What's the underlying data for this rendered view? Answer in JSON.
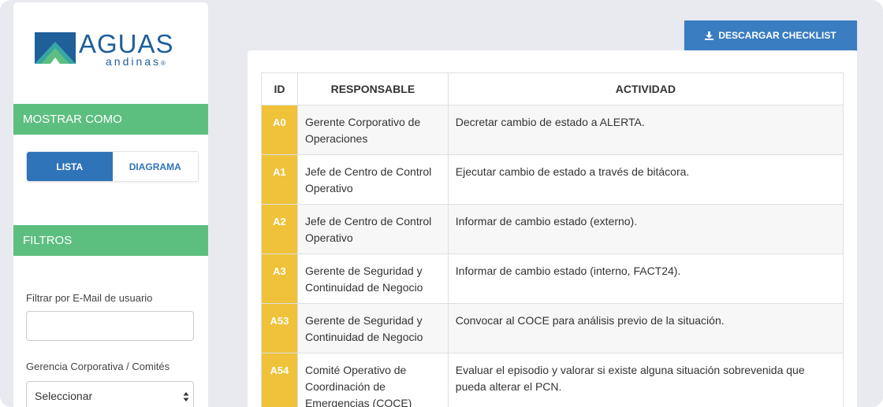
{
  "brand": {
    "name": "AGUAS",
    "sub": "andinas",
    "mark": "®",
    "colors": {
      "blue": "#1f5f9a",
      "green": "#5cbf80",
      "teal": "#38a7a3"
    }
  },
  "sidebar": {
    "show_as_header": "MOSTRAR COMO",
    "view_toggle": {
      "list_label": "LISTA",
      "diagram_label": "DIAGRAMA",
      "selected": "LISTA"
    },
    "filters_header": "FILTROS",
    "email_filter": {
      "label": "Filtrar por E-Mail de usuario",
      "value": "",
      "placeholder": ""
    },
    "management_filter": {
      "label": "Gerencia Corporativa / Comités",
      "selected": "Seleccionar"
    }
  },
  "main": {
    "download_button": {
      "label": "DESCARGAR CHECKLIST",
      "icon": "download-icon"
    },
    "table": {
      "headers": [
        "ID",
        "RESPONSABLE",
        "ACTIVIDAD"
      ],
      "rows": [
        {
          "id": "A0",
          "responsible": "Gerente Corporativo de Operaciones",
          "activity": "Decretar cambio de estado a ALERTA."
        },
        {
          "id": "A1",
          "responsible": "Jefe de Centro de Control Operativo",
          "activity": "Ejecutar cambio de estado a través de bitácora."
        },
        {
          "id": "A2",
          "responsible": "Jefe de Centro de Control Operativo",
          "activity": "Informar de cambio estado (externo)."
        },
        {
          "id": "A3",
          "responsible": "Gerente de Seguridad y Continuidad de Negocio",
          "activity": "Informar de cambio estado (interno, FACT24)."
        },
        {
          "id": "A53",
          "responsible": "Gerente de Seguridad y Continuidad de Negocio",
          "activity": "Convocar al COCE para análisis previo de la situación."
        },
        {
          "id": "A54",
          "responsible": "Comité Operativo de Coordinación de Emergencias (COCE)",
          "activity": "Evaluar el episodio y valorar si existe alguna situación sobrevenida que pueda alterar el PCN."
        }
      ]
    }
  }
}
